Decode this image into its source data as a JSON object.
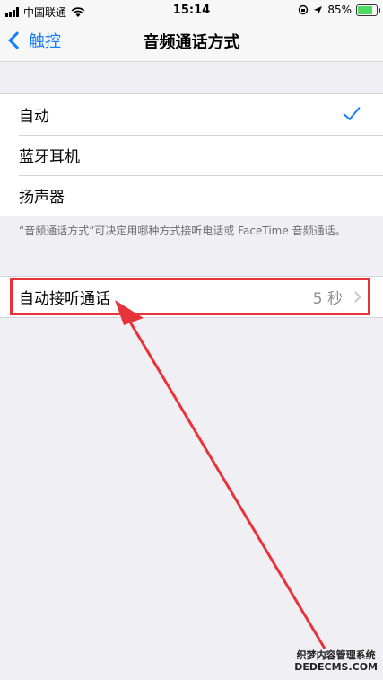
{
  "status_bar": {
    "carrier": "中国联通",
    "time": "15:14",
    "battery_percent": "85%",
    "battery_level": 0.85,
    "icons": [
      "signal-icon",
      "wifi-icon",
      "lock-rotation-icon",
      "location-icon",
      "battery-icon"
    ]
  },
  "nav": {
    "back_label": "触控",
    "title": "音频通话方式"
  },
  "call_audio_routing": {
    "options": [
      {
        "label": "自动",
        "selected": true
      },
      {
        "label": "蓝牙耳机",
        "selected": false
      },
      {
        "label": "扬声器",
        "selected": false
      }
    ],
    "footer": "“音频通话方式”可决定用哪种方式接听电话或 FaceTime 音频通话。"
  },
  "auto_answer": {
    "label": "自动接听通话",
    "value": "5 秒"
  },
  "annotation": {
    "highlight_color": "#e8333a"
  },
  "watermark": {
    "line1": "织梦内容管理系统",
    "line2": "DEDECMS.COM"
  },
  "colors": {
    "accent": "#147efb",
    "background": "#efeff4",
    "annotation_red": "#e8333a"
  }
}
